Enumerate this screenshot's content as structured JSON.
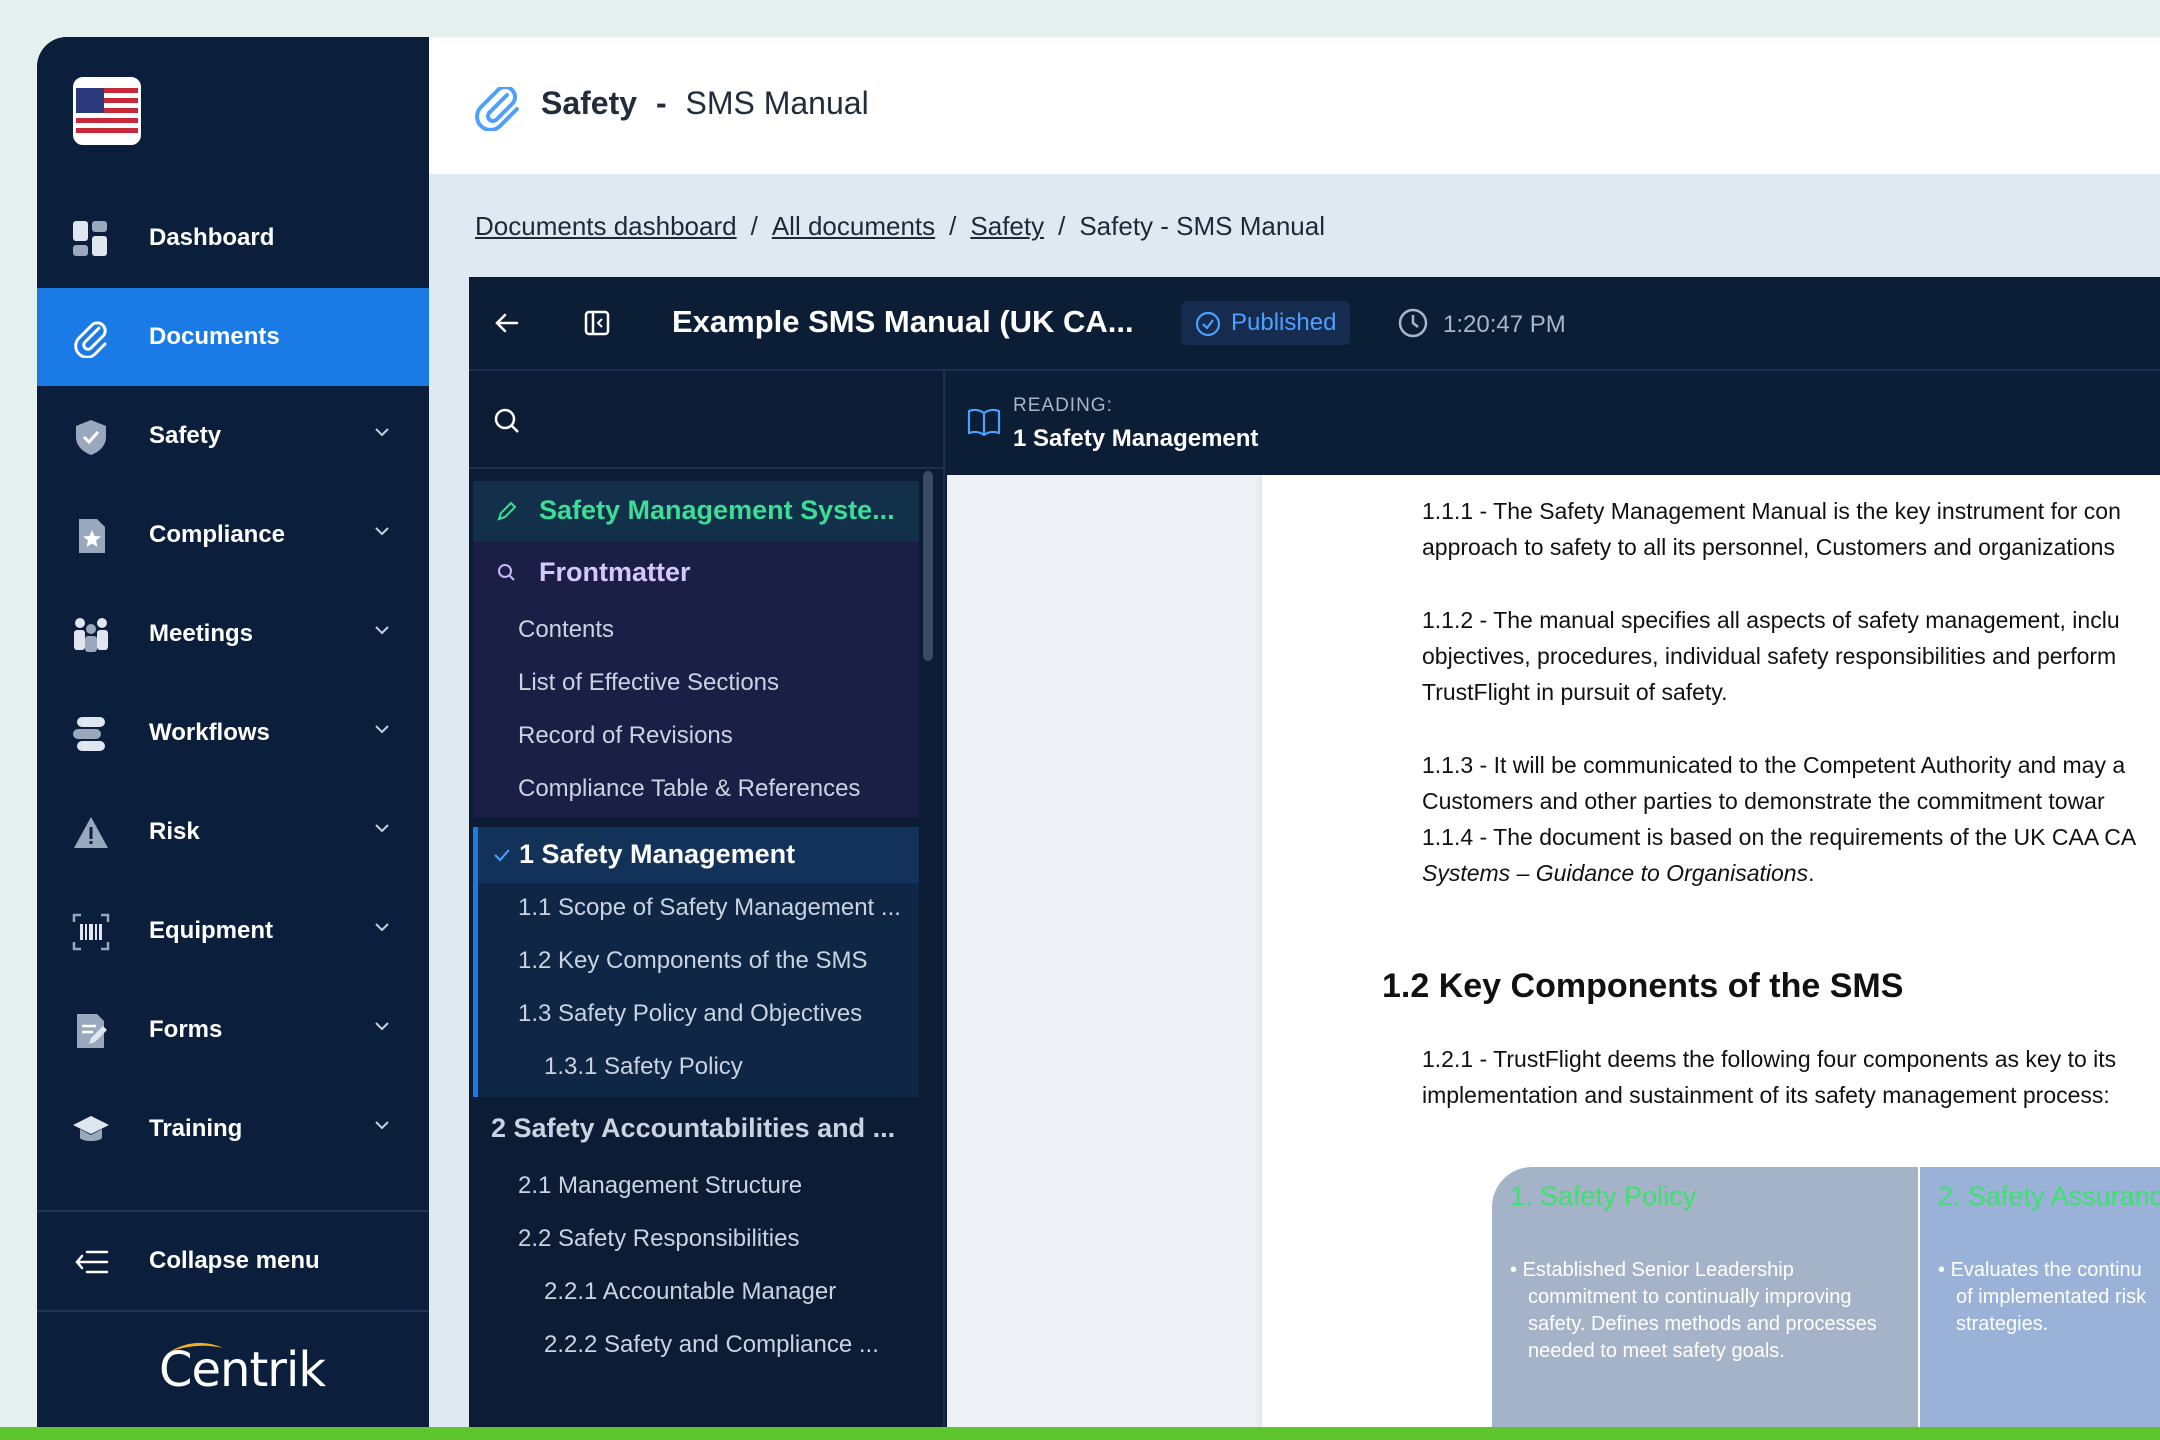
{
  "sidebar": {
    "items": [
      {
        "label": "Dashboard"
      },
      {
        "label": "Documents"
      },
      {
        "label": "Safety"
      },
      {
        "label": "Compliance"
      },
      {
        "label": "Meetings"
      },
      {
        "label": "Workflows"
      },
      {
        "label": "Risk"
      },
      {
        "label": "Equipment"
      },
      {
        "label": "Forms"
      },
      {
        "label": "Training"
      }
    ],
    "collapse_label": "Collapse menu",
    "logo_text": "Centrik"
  },
  "header": {
    "title_prefix": "Safety",
    "separator": "-",
    "title": "SMS Manual"
  },
  "breadcrumb": {
    "items": [
      "Documents dashboard",
      "All documents",
      "Safety"
    ],
    "current": "Safety - SMS Manual",
    "sep": "/"
  },
  "viewer": {
    "doc_title": "Example SMS Manual (UK CA...",
    "status": "Published",
    "time": "1:20:47 PM",
    "reading_label": "READING:",
    "reading_section": "1 Safety Management"
  },
  "toc": {
    "root": "Safety Management Syste...",
    "frontmatter": "Frontmatter",
    "frontmatter_items": [
      "Contents",
      "List of Effective Sections",
      "Record of Revisions",
      "Compliance Table & References"
    ],
    "section1": "1 Safety Management",
    "section1_items": [
      "1.1 Scope of Safety Management ...",
      "1.2 Key Components of the SMS",
      "1.3 Safety Policy and Objectives"
    ],
    "section1_sub": "1.3.1 Safety Policy",
    "section2": "2 Safety Accountabilities and ...",
    "section2_items": [
      "2.1 Management Structure",
      "2.2 Safety Responsibilities"
    ],
    "section2_sub": [
      "2.2.1 Accountable Manager",
      "2.2.2 Safety and Compliance ..."
    ]
  },
  "content": {
    "p1a": "1.1.1 -  The Safety Management Manual is the key instrument for con",
    "p1b": "approach to safety to all its personnel, Customers and organizations",
    "p2a": "1.1.2 - The manual specifies all aspects of safety management, inclu",
    "p2b": "objectives, procedures, individual safety responsibilities and perform",
    "p2c": "TrustFlight in pursuit of safety.",
    "p3a": "1.1.3 - It will be communicated to the Competent Authority and may a",
    "p3b": "Customers and other parties to demonstrate the commitment towar",
    "p4a": "1.1.4 - The document is based on the requirements of the UK CAA CA",
    "p4b": "Systems – Guidance to Organisations",
    "p4b_end": ".",
    "h2": "1.2 Key Components of the SMS",
    "p5a": "1.2.1 - TrustFlight deems the following four components as key to its",
    "p5b": "implementation and sustainment of its safety management process:",
    "card1_title": "1. Safety Policy",
    "card1_text": [
      "Established Senior Leadership",
      "commitment to continually improving",
      "safety. Defines methods and processes",
      "needed to meet safety goals."
    ],
    "card2_title": "2. Safety Assuranc",
    "card2_text": [
      "Evaluates the continu",
      "of implementated risk",
      "strategies."
    ]
  },
  "colors": {
    "accent": "#1a7ae6",
    "nav_bg": "#0b1f3d",
    "published": "#4ea0ff",
    "toc_root": "#3ddc97",
    "card_title": "#3be26b"
  }
}
